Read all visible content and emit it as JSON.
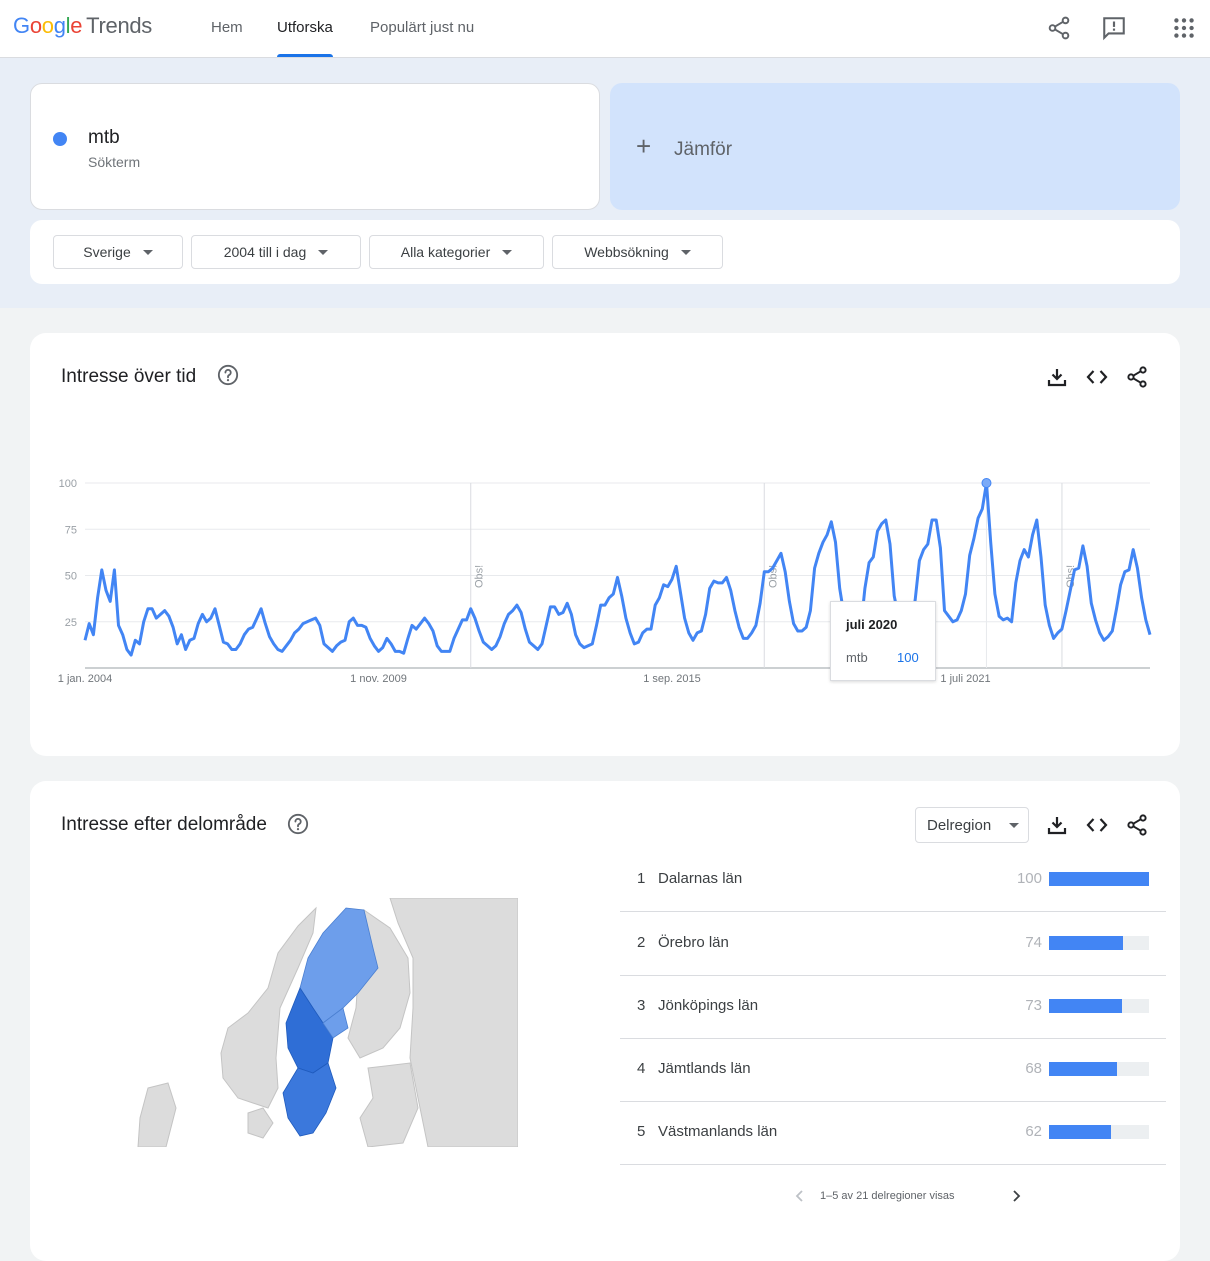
{
  "logo": {
    "google": "Google",
    "trends": "Trends"
  },
  "nav": {
    "items": [
      "Hem",
      "Utforska",
      "Populärt just nu"
    ],
    "active": "Utforska"
  },
  "top_icons": [
    "share-icon",
    "feedback-icon",
    "apps-grid-icon"
  ],
  "search_term": {
    "name": "mtb",
    "type": "Sökterm",
    "color": "#4285f4"
  },
  "compare": {
    "label": "Jämför"
  },
  "filters": {
    "location": "Sverige",
    "period": "2004 till i dag",
    "category": "Alla kategorier",
    "search_type": "Webbsökning"
  },
  "interest_over_time": {
    "title": "Intresse över tid",
    "tooltip": {
      "date": "juli 2020",
      "term": "mtb",
      "value": "100"
    },
    "obs_label": "Obs!"
  },
  "chart_data": {
    "type": "line",
    "series": [
      {
        "name": "mtb",
        "color": "#4285f4",
        "values": [
          15,
          24,
          18,
          38,
          53,
          42,
          36,
          53,
          23,
          18,
          10,
          7,
          15,
          13,
          25,
          32,
          32,
          27,
          29,
          31,
          28,
          22,
          13,
          18,
          10,
          15,
          16,
          24,
          29,
          25,
          27,
          32,
          23,
          14,
          13,
          10,
          10,
          13,
          18,
          21,
          22,
          27,
          32,
          24,
          17,
          13,
          10,
          9,
          12,
          15,
          19,
          21,
          24,
          25,
          26,
          27,
          23,
          13,
          11,
          9,
          12,
          14,
          15,
          25,
          27,
          23,
          23,
          22,
          16,
          12,
          9,
          11,
          16,
          13,
          9,
          9,
          8,
          16,
          23,
          21,
          24,
          27,
          24,
          20,
          12,
          9,
          9,
          9,
          16,
          21,
          26,
          26,
          32,
          27,
          20,
          14,
          12,
          10,
          12,
          17,
          24,
          29,
          31,
          34,
          30,
          21,
          14,
          12,
          10,
          13,
          23,
          33,
          33,
          29,
          30,
          35,
          29,
          18,
          13,
          11,
          12,
          13,
          23,
          34,
          34,
          38,
          40,
          49,
          39,
          27,
          19,
          13,
          14,
          19,
          21,
          21,
          34,
          38,
          45,
          44,
          48,
          55,
          41,
          27,
          19,
          15,
          19,
          20,
          29,
          43,
          47,
          46,
          46,
          49,
          42,
          31,
          22,
          16,
          16,
          19,
          23,
          35,
          52,
          52,
          54,
          58,
          62,
          52,
          36,
          24,
          20,
          20,
          22,
          31,
          54,
          62,
          68,
          72,
          79,
          68,
          43,
          29,
          22,
          21,
          20,
          21,
          43,
          57,
          60,
          74,
          78,
          80,
          67,
          39,
          28,
          23,
          22,
          22,
          37,
          58,
          64,
          67,
          80,
          80,
          65,
          31,
          28,
          25,
          26,
          31,
          40,
          61,
          70,
          81,
          86,
          100,
          68,
          40,
          28,
          26,
          27,
          25,
          46,
          58,
          64,
          60,
          72,
          80,
          60,
          34,
          23,
          16,
          19,
          21,
          31,
          42,
          53,
          54,
          66,
          55,
          35,
          26,
          19,
          15,
          17,
          20,
          32,
          45,
          52,
          53,
          64,
          54,
          38,
          26,
          18
        ]
      }
    ],
    "x_tick_labels": [
      "1 jan. 2004",
      "1 nov. 2009",
      "1 sep. 2015",
      "1 juli 2021"
    ],
    "y_tick_labels": [
      "100",
      "75",
      "50",
      "25"
    ],
    "ylim": [
      0,
      100
    ],
    "x_range": [
      "jan. 2004",
      "2022"
    ],
    "highlight": {
      "label": "juli 2020",
      "value": 100
    },
    "grid": true
  },
  "interest_by_region": {
    "title": "Intresse efter delområde",
    "resolution": "Delregion",
    "rows": [
      {
        "rank": "1",
        "name": "Dalarnas län",
        "value": 100
      },
      {
        "rank": "2",
        "name": "Örebro län",
        "value": 74
      },
      {
        "rank": "3",
        "name": "Jönköpings län",
        "value": 73
      },
      {
        "rank": "4",
        "name": "Jämtlands län",
        "value": 68
      },
      {
        "rank": "5",
        "name": "Västmanlands län",
        "value": 62
      }
    ],
    "pagination": "1–5 av 21 delregioner visas"
  }
}
